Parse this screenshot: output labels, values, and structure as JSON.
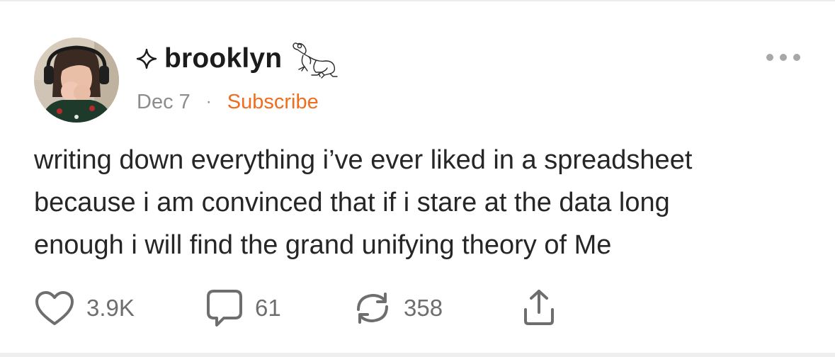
{
  "post": {
    "author": {
      "name": "brooklyn",
      "badge_icon": "sparkle-icon",
      "name_decoration_icon": "frog-icon"
    },
    "date": "Dec 7",
    "separator": "·",
    "subscribe_label": "Subscribe",
    "body_lines": [
      "writing down everything i’ve ever liked in a spreadsheet",
      "because i am convinced that if i stare at the data long",
      "enough i will find the grand unifying theory of Me"
    ],
    "actions": {
      "like": {
        "icon": "heart-icon",
        "count": "3.9K"
      },
      "comment": {
        "icon": "comment-bubble-icon",
        "count": "61"
      },
      "restack": {
        "icon": "restack-arrows-icon",
        "count": "358"
      },
      "share": {
        "icon": "share-upload-icon"
      }
    },
    "more_icon": "more-dots-icon"
  },
  "colors": {
    "accent": "#ef6d1e",
    "meta_text": "#8c8c8c",
    "body_text": "#262626",
    "icon": "#6e6e6e"
  }
}
